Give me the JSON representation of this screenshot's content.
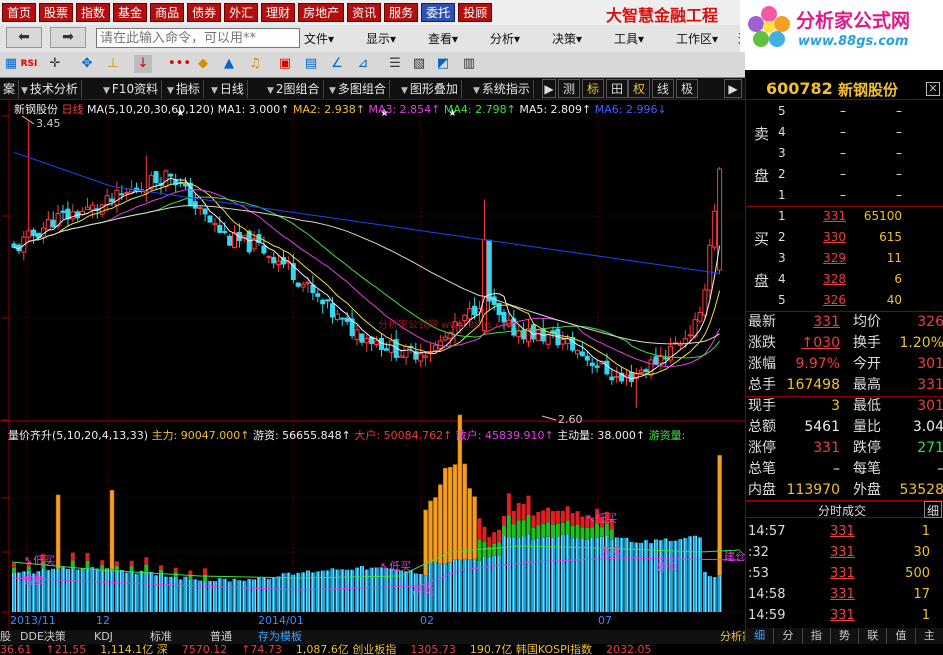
{
  "menu": [
    "首页",
    "股票",
    "指数",
    "基金",
    "商品",
    "债券",
    "外汇",
    "理财",
    "房地产",
    "资讯",
    "服务",
    "委托",
    "投顾"
  ],
  "brand": "大智慧金融工程",
  "logo": {
    "title": "分析家公式网",
    "url": "www.88gs.com"
  },
  "toolbar": {
    "cmd_placeholder": "请在此输入命令，可以用**",
    "menus": [
      "文件▾",
      "显示▾",
      "查看▾",
      "分析▾",
      "决策▾",
      "工具▾",
      "工作区▾",
      "近"
    ]
  },
  "tabs": [
    "案",
    "技术分析",
    "F10资料",
    "指标",
    "日线",
    "2图组合",
    "多图组合",
    "图形叠加",
    "系统指示"
  ],
  "small_btns": [
    "测",
    "标",
    "田",
    "权",
    "线",
    "极"
  ],
  "stock": {
    "code": "600782",
    "name": "新钢股份"
  },
  "kline_info": {
    "name": "新钢股份",
    "period": "日线",
    "ma_params": "MA(5,10,20,30,60,120)",
    "ma1": "MA1: 3.000↑",
    "ma2": "MA2: 2.938↑",
    "ma3": "MA3: 2.854↑",
    "ma4": "MA4: 2.798↑",
    "ma5": "MA5: 2.809↑",
    "ma6": "MA6: 2.996↓",
    "high_label": "3.45",
    "low_label": "2.60",
    "watermark": "分析家公式网 www.88gs.com"
  },
  "vol_info": {
    "name": "量价齐升",
    "params": "(5,10,20,4,13,33)",
    "zhuli": "主力: 90047.000↑",
    "youzi": "游资: 56655.848↑",
    "dahu": "大户: 50084.762↑",
    "sanhu": "散户: 45839.910↑",
    "zhudong": "主动量: 38.000↑",
    "youzi2": "游资量:"
  },
  "annotations": {
    "di_mai": "↖低买",
    "gao_mai": "高卖",
    "jiancang": "建仓"
  },
  "dates": [
    "2013/11",
    "12",
    "2014/01",
    "02",
    "07"
  ],
  "chart_data": {
    "type": "candlestick",
    "high": 3.45,
    "low": 2.6,
    "last": 3.31,
    "ma": [
      {
        "name": "MA1",
        "value": 3.0
      },
      {
        "name": "MA2",
        "value": 2.938
      },
      {
        "name": "MA3",
        "value": 2.854
      },
      {
        "name": "MA4",
        "value": 2.798
      },
      {
        "name": "MA5",
        "value": 2.809
      },
      {
        "name": "MA6",
        "value": 2.996
      }
    ]
  },
  "orderbook": {
    "sell_label": [
      "卖",
      "盘"
    ],
    "buy_label": [
      "买",
      "盘"
    ],
    "sell": [
      {
        "lv": "5",
        "pr": "–",
        "vo": "–"
      },
      {
        "lv": "4",
        "pr": "–",
        "vo": "–"
      },
      {
        "lv": "3",
        "pr": "–",
        "vo": "–"
      },
      {
        "lv": "2",
        "pr": "–",
        "vo": "–"
      },
      {
        "lv": "1",
        "pr": "–",
        "vo": "–"
      }
    ],
    "buy": [
      {
        "lv": "1",
        "pr": "331",
        "vo": "65100"
      },
      {
        "lv": "2",
        "pr": "330",
        "vo": "615"
      },
      {
        "lv": "3",
        "pr": "329",
        "vo": "11"
      },
      {
        "lv": "4",
        "pr": "328",
        "vo": "6"
      },
      {
        "lv": "5",
        "pr": "326",
        "vo": "40"
      }
    ]
  },
  "quotes": [
    {
      "l": "最新",
      "v": "331",
      "l2": "均价",
      "v2": "326"
    },
    {
      "l": "涨跌",
      "v": "↑030",
      "l2": "换手",
      "v2": "1.20%"
    },
    {
      "l": "涨幅",
      "v": "9.97%",
      "l2": "今开",
      "v2": "301"
    },
    {
      "l": "总手",
      "v": "167498",
      "l2": "最高",
      "v2": "331"
    },
    {
      "l": "现手",
      "v": "3",
      "l2": "最低",
      "v2": "301"
    },
    {
      "l": "总额",
      "v": "5461",
      "l2": "量比",
      "v2": "3.04"
    },
    {
      "l": "涨停",
      "v": "331",
      "l2": "跌停",
      "v2": "271"
    },
    {
      "l": "总笔",
      "v": "–",
      "l2": "每笔",
      "v2": "–"
    },
    {
      "l": "内盘",
      "v": "113970",
      "l2": "外盘",
      "v2": "53528"
    }
  ],
  "trades_header": "分时成交",
  "trades_btn": "细",
  "trades": [
    {
      "t": "14:57",
      "p": "331",
      "v": "1"
    },
    {
      "t": ":32",
      "p": "331",
      "v": "30"
    },
    {
      "t": ":53",
      "p": "331",
      "v": "500"
    },
    {
      "t": "14:58",
      "p": "331",
      "v": "17"
    },
    {
      "t": "14:59",
      "p": "331",
      "v": "1"
    }
  ],
  "rp_bottom": [
    "细",
    "分",
    "指",
    "势",
    "联",
    "值",
    "主"
  ],
  "bottom_tabs": [
    "股",
    "DDE决策",
    "KDJ",
    "标准",
    "普通",
    "存为模板"
  ],
  "status": [
    {
      "t": "36.61",
      "c": "red"
    },
    {
      "t": "↑21.55",
      "c": "red"
    },
    {
      "t": "1,114.1亿 深",
      "c": "yel"
    },
    {
      "t": "7570.12",
      "c": "red"
    },
    {
      "t": "↑74.73",
      "c": "red"
    },
    {
      "t": "1,087.6亿 创业板指",
      "c": "yel"
    },
    {
      "t": "1305.73",
      "c": "red"
    },
    {
      "t": "190.7亿 韩国KOSPI指数",
      "c": "yel"
    },
    {
      "t": "2032.05",
      "c": "red"
    }
  ]
}
